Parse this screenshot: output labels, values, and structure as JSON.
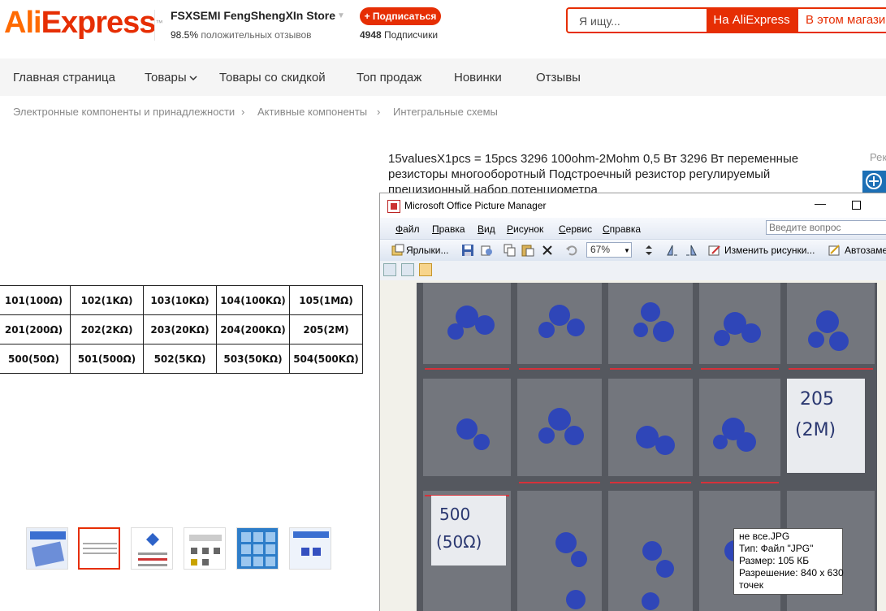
{
  "header": {
    "logo_ali": "Ali",
    "logo_express": "Express",
    "store_name": "FSXSEMI FengShengXIn Store",
    "rating_value": "98.5%",
    "rating_label": "положительных отзывов",
    "subscribe_label": "+ Подписаться",
    "subscribers_count": "4948",
    "subscribers_label": "Подписчики",
    "search_placeholder": "Я ищу...",
    "search_aliexpress_label": "На AliExpress",
    "search_store_label": "В этом магазине"
  },
  "nav": {
    "items": [
      "Главная страница",
      "Товары",
      "Товары со скидкой",
      "Топ продаж",
      "Новинки",
      "Отзывы"
    ]
  },
  "breadcrumbs": [
    "Электронные компоненты и принадлежности",
    "Активные компоненты",
    "Интегральные схемы"
  ],
  "product": {
    "title": "15valuesX1pcs = 15pcs 3296 100ohm-2Mohm 0,5 Вт 3296 Вт переменные резисторы многооборотный Подстроечный резистор регулируемый прецизионный набор потенциометра",
    "side_label": "Рек",
    "code_table": [
      [
        "101(100Ω)",
        "102(1KΩ)",
        "103(10KΩ)",
        "104(100KΩ)",
        "105(1MΩ)"
      ],
      [
        "201(200Ω)",
        "202(2KΩ)",
        "203(20KΩ)",
        "204(200KΩ)",
        "205(2M)"
      ],
      [
        "500(50Ω)",
        "501(500Ω)",
        "502(5KΩ)",
        "503(50KΩ)",
        "504(500KΩ)"
      ]
    ],
    "thumbnail_count": 6,
    "selected_thumbnail": 1
  },
  "picture_manager": {
    "title": "Microsoft Office Picture Manager",
    "menus": [
      {
        "hot": "Ф",
        "rest": "айл"
      },
      {
        "hot": "П",
        "rest": "равка"
      },
      {
        "hot": "В",
        "rest": "ид"
      },
      {
        "hot": "Р",
        "rest": "исунок"
      },
      {
        "hot": "С",
        "rest": "ервис"
      },
      {
        "hot": "С",
        "rest": "правка"
      }
    ],
    "help_placeholder": "Введите вопрос",
    "toolbar": {
      "shortcuts_label": "Ярлыки...",
      "zoom_value": "67%",
      "edit_label": "Изменить рисунки...",
      "autocorrect_label": "Автозаме"
    },
    "photo_labels": {
      "label_a_line1": "205",
      "label_a_line2": "(2M)",
      "label_b_line1": "500",
      "label_b_line2": "(50Ω)"
    },
    "tooltip": {
      "filename": "не все.JPG",
      "type": "Тип: Файл \"JPG\"",
      "size": "Размер: 105 КБ",
      "resolution": "Разрешение: 840 x 630",
      "resolution_unit": "точек"
    }
  },
  "colors": {
    "brand_red": "#e62e04",
    "brand_orange": "#ff6a00",
    "nav_bg": "#f5f5f5"
  }
}
